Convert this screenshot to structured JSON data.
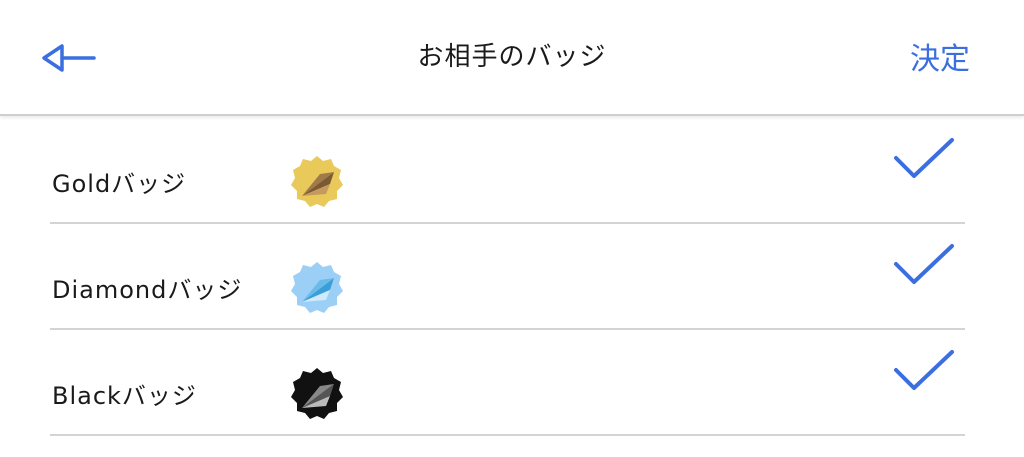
{
  "header": {
    "title": "お相手のバッジ",
    "confirm_label": "決定",
    "back_icon": "arrow-left-icon"
  },
  "badges": [
    {
      "label": "Goldバッジ",
      "icon": "gold-badge-icon",
      "checked": true
    },
    {
      "label": "Diamondバッジ",
      "icon": "diamond-badge-icon",
      "checked": true
    },
    {
      "label": "Blackバッジ",
      "icon": "black-badge-icon",
      "checked": true
    }
  ],
  "colors": {
    "accent": "#3b6fe0",
    "divider": "#d4d4d4",
    "gold": "#e8c95a",
    "diamond": "#9ccff5",
    "black": "#111111"
  }
}
